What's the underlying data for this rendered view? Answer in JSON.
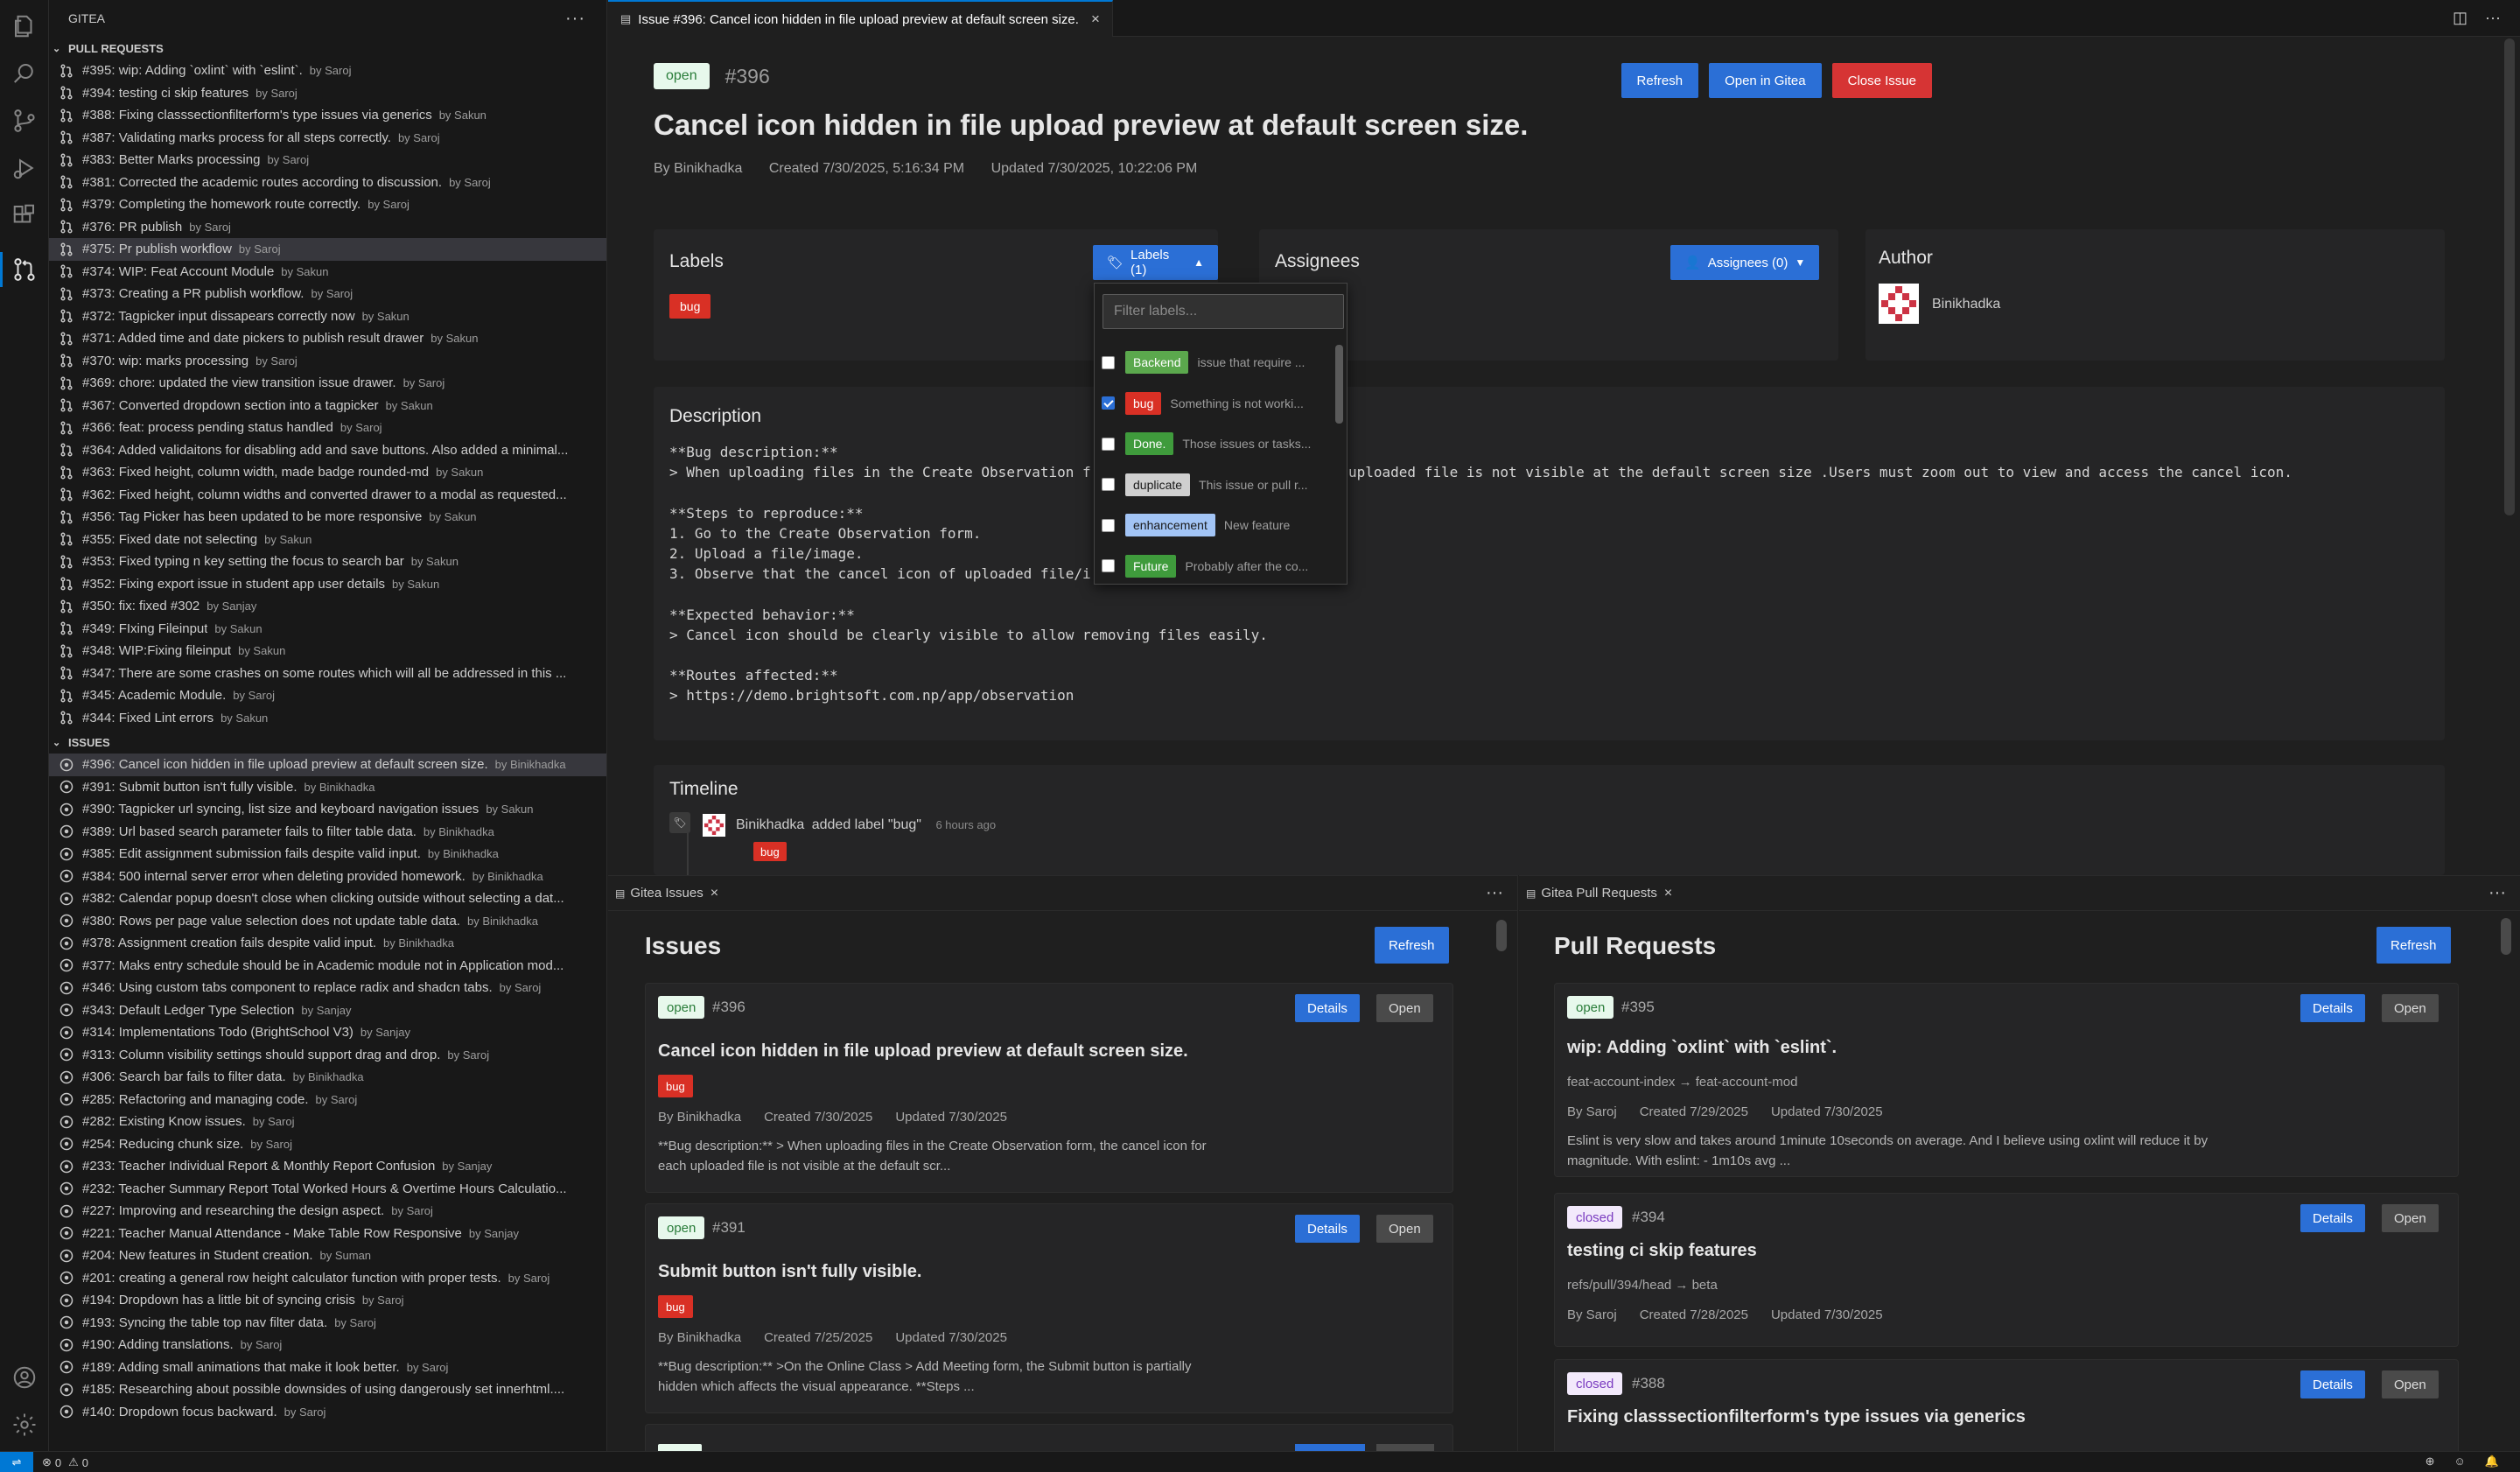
{
  "sidebar": {
    "title": "GITEA",
    "more": "···",
    "pr_section": "PULL REQUESTS",
    "issue_section": "ISSUES",
    "pull_requests": [
      {
        "title": "#395: wip: Adding `oxlint` with `eslint`.",
        "by": "by Saroj"
      },
      {
        "title": "#394: testing ci skip features",
        "by": "by Saroj"
      },
      {
        "title": "#388: Fixing classsectionfilterform's type issues via generics",
        "by": "by Sakun"
      },
      {
        "title": "#387: Validating marks process for all steps correctly.",
        "by": "by Saroj"
      },
      {
        "title": "#383: Better Marks processing",
        "by": "by Saroj"
      },
      {
        "title": "#381: Corrected the academic routes according to discussion.",
        "by": "by Saroj"
      },
      {
        "title": "#379: Completing the homework route correctly.",
        "by": "by Saroj"
      },
      {
        "title": "#376: PR publish",
        "by": "by Saroj"
      },
      {
        "title": "#375: Pr publish workflow",
        "by": "by Saroj"
      },
      {
        "title": "#374: WIP: Feat Account Module",
        "by": "by Sakun"
      },
      {
        "title": "#373: Creating a PR publish workflow.",
        "by": "by Saroj"
      },
      {
        "title": "#372: Tagpicker input dissapears correctly now",
        "by": "by Sakun"
      },
      {
        "title": "#371: Added time and date pickers to publish result drawer",
        "by": "by Sakun"
      },
      {
        "title": "#370: wip: marks processing",
        "by": "by Saroj"
      },
      {
        "title": "#369: chore: updated the view transition issue drawer.",
        "by": "by Saroj"
      },
      {
        "title": "#367: Converted dropdown  section into a tagpicker",
        "by": "by Sakun"
      },
      {
        "title": "#366: feat: process pending status handled",
        "by": "by Saroj"
      },
      {
        "title": "#364: Added validaitons for disabling add and save buttons. Also added a minimal...",
        "by": ""
      },
      {
        "title": "#363: Fixed height, column width, made badge rounded-md",
        "by": "by Sakun"
      },
      {
        "title": "#362: Fixed height, column widths and converted drawer to a modal as requested...",
        "by": ""
      },
      {
        "title": "#356: Tag Picker has been updated to be more responsive",
        "by": "by Sakun"
      },
      {
        "title": "#355: Fixed date not selecting",
        "by": "by Sakun"
      },
      {
        "title": "#353: Fixed typing n key setting the focus to search bar",
        "by": "by Sakun"
      },
      {
        "title": "#352: Fixing export issue in student app user details",
        "by": "by Sakun"
      },
      {
        "title": "#350: fix: fixed #302",
        "by": "by Sanjay"
      },
      {
        "title": "#349: FIxing Fileinput",
        "by": "by Sakun"
      },
      {
        "title": "#348: WIP:Fixing fileinput",
        "by": "by Sakun"
      },
      {
        "title": "#347: There are some crashes on some routes which will all be addressed in this ...",
        "by": ""
      },
      {
        "title": "#345: Academic Module.",
        "by": "by Saroj"
      },
      {
        "title": "#344: Fixed Lint errors",
        "by": "by Sakun"
      }
    ],
    "issues": [
      {
        "title": "#396: Cancel icon hidden in file upload preview at default screen size.",
        "by": "by Binikhadka"
      },
      {
        "title": "#391: Submit button isn't fully visible.",
        "by": "by Binikhadka"
      },
      {
        "title": "#390: Tagpicker url syncing, list size and keyboard navigation issues",
        "by": "by Sakun"
      },
      {
        "title": "#389: Url based search parameter fails to filter table data.",
        "by": "by Binikhadka"
      },
      {
        "title": "#385: Edit assignment submission fails despite valid input.",
        "by": "by Binikhadka"
      },
      {
        "title": "#384: 500 internal server error when deleting provided homework.",
        "by": "by Binikhadka"
      },
      {
        "title": "#382: Calendar popup doesn't close when clicking outside without selecting a dat...",
        "by": ""
      },
      {
        "title": "#380: Rows per page value selection does not update table data.",
        "by": "by Binikhadka"
      },
      {
        "title": "#378: Assignment creation fails despite valid input.",
        "by": "by Binikhadka"
      },
      {
        "title": "#377: Maks entry schedule should be in Academic module not in Application mod...",
        "by": ""
      },
      {
        "title": "#346: Using custom tabs component to replace radix and shadcn tabs.",
        "by": "by Saroj"
      },
      {
        "title": "#343: Default Ledger Type Selection",
        "by": "by Sanjay"
      },
      {
        "title": "#314: Implementations Todo  (BrightSchool V3)",
        "by": "by Sanjay"
      },
      {
        "title": "#313: Column visibility settings should support drag and drop.",
        "by": "by Saroj"
      },
      {
        "title": "#306: Search bar fails to filter data.",
        "by": "by Binikhadka"
      },
      {
        "title": "#285: Refactoring and managing code.",
        "by": "by Saroj"
      },
      {
        "title": "#282: Existing Know issues.",
        "by": "by Saroj"
      },
      {
        "title": "#254: Reducing chunk size.",
        "by": "by Saroj"
      },
      {
        "title": "#233: Teacher Individual Report & Monthly Report Confusion",
        "by": "by Sanjay"
      },
      {
        "title": "#232: Teacher Summary Report  Total Worked Hours & Overtime Hours Calculatio...",
        "by": ""
      },
      {
        "title": "#227: Improving and researching the design aspect.",
        "by": "by Saroj"
      },
      {
        "title": "#221: Teacher Manual Attendance - Make Table Row Responsive",
        "by": "by Sanjay"
      },
      {
        "title": "#204: New features in Student creation.",
        "by": "by Suman"
      },
      {
        "title": "#201: creating a general row height calculator function with proper tests.",
        "by": "by Saroj"
      },
      {
        "title": "#194: Dropdown has a little bit of syncing crisis",
        "by": "by Saroj"
      },
      {
        "title": "#193: Syncing the table top nav filter data.",
        "by": "by Saroj"
      },
      {
        "title": "#190: Adding translations.",
        "by": "by Saroj"
      },
      {
        "title": "#189: Adding small animations that make it look better.",
        "by": "by Saroj"
      },
      {
        "title": "#185: Researching about possible downsides of using dangerously set innerhtml....",
        "by": ""
      },
      {
        "title": "#140: Dropdown focus backward.",
        "by": "by Saroj"
      }
    ]
  },
  "editor": {
    "tab_label": "Issue #396: Cancel icon hidden in file upload preview at default screen size.",
    "status": "open",
    "number": "#396",
    "title": "Cancel icon hidden in file upload preview at default screen size.",
    "author_line": "By Binikhadka",
    "created": "Created 7/30/2025, 5:16:34 PM",
    "updated": "Updated 7/30/2025, 10:22:06 PM",
    "refresh": "Refresh",
    "open_in_gitea": "Open in Gitea",
    "close_issue": "Close Issue",
    "labels_heading": "Labels",
    "labels_button": "Labels (1)",
    "current_label": "bug",
    "assignees_heading": "Assignees",
    "assignees_button": "Assignees (0)",
    "assignees_partial": "es",
    "author_heading": "Author",
    "author_name": "Binikhadka",
    "description_heading": "Description",
    "description_left": "**Bug description:**\n> When uploading files in the Create Observation f\n\n**Steps to reproduce:**\n1. Go to the Create Observation form.\n2. Upload a file/image.\n3. Observe that the cancel icon of uploaded file/i\n\n**Expected behavior:**\n> Cancel icon should be clearly visible to allow removing files easily.\n\n**Routes affected:**\n> https://demo.brightsoft.com.np/app/observation",
    "description_right": "uploaded file is not visible at the default screen size .Users must zoom out to view and access the cancel icon.",
    "timeline_heading": "Timeline",
    "timeline_user": "Binikhadka",
    "timeline_action": "added label \"bug\"",
    "timeline_time": "6 hours ago",
    "timeline_label": "bug"
  },
  "dropdown": {
    "placeholder": "Filter labels...",
    "labels": [
      {
        "name": "Backend",
        "desc": "issue that require ...",
        "color": "#5ba84d",
        "checked": false
      },
      {
        "name": "bug",
        "desc": "Something is not worki...",
        "color": "#d93025",
        "checked": true
      },
      {
        "name": "Done.",
        "desc": "Those issues or tasks...",
        "color": "#3f9b3c",
        "checked": false
      },
      {
        "name": "duplicate",
        "desc": "This issue or pull r...",
        "color": "#cfcfcf",
        "checked": false
      },
      {
        "name": "enhancement",
        "desc": "New feature",
        "color": "#a2c4f5",
        "checked": false
      },
      {
        "name": "Future",
        "desc": "Probably after the co...",
        "color": "#3f9b3c",
        "checked": false
      }
    ]
  },
  "issues_panel": {
    "tab": "Gitea Issues",
    "heading": "Issues",
    "refresh": "Refresh",
    "cards": [
      {
        "status": "open",
        "number": "#396",
        "title": "Cancel icon hidden in file upload preview at default screen size.",
        "label": "bug",
        "by": "By Binikhadka",
        "created": "Created 7/30/2025",
        "updated": "Updated 7/30/2025",
        "snippet1": "**Bug description:** > When uploading files in the Create Observation form, the cancel icon for",
        "snippet2": "each uploaded file is not visible at the default scr...",
        "details": "Details",
        "open": "Open"
      },
      {
        "status": "open",
        "number": "#391",
        "title": "Submit button isn't fully visible.",
        "label": "bug",
        "by": "By Binikhadka",
        "created": "Created 7/25/2025",
        "updated": "Updated 7/30/2025",
        "snippet1": "**Bug description:** >On the Online Class > Add Meeting form, the Submit button is partially",
        "snippet2": "hidden which affects the visual appearance. **Steps ...",
        "details": "Details",
        "open": "Open"
      }
    ]
  },
  "prs_panel": {
    "tab": "Gitea Pull Requests",
    "heading": "Pull Requests",
    "refresh": "Refresh",
    "cards": [
      {
        "status": "open",
        "number": "#395",
        "title": "wip: Adding `oxlint` with `eslint`.",
        "branch": "feat-account-index → feat-account-mod",
        "by": "By Saroj",
        "created": "Created 7/29/2025",
        "updated": "Updated 7/30/2025",
        "snippet1": "Eslint is very slow and takes around 1minute 10seconds on average. And I believe using oxlint will reduce it by",
        "snippet2": "magnitude. With eslint: - 1m10s avg ...",
        "details": "Details",
        "open": "Open"
      },
      {
        "status": "closed",
        "number": "#394",
        "title": "testing ci skip features",
        "branch": "refs/pull/394/head → beta",
        "by": "By Saroj",
        "created": "Created 7/28/2025",
        "updated": "Updated 7/30/2025",
        "details": "Details",
        "open": "Open"
      },
      {
        "status": "closed",
        "number": "#388",
        "title": "Fixing classsectionfilterform's type issues via generics",
        "details": "Details",
        "open": "Open"
      }
    ]
  },
  "statusbar": {
    "errors": "0",
    "warnings": "0"
  }
}
